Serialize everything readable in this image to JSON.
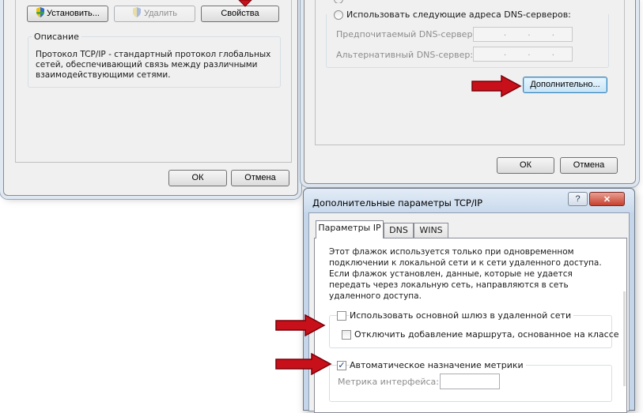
{
  "left_window": {
    "install_label": "Установить...",
    "remove_label": "Удалить",
    "properties_label": "Свойства",
    "description_title": "Описание",
    "description_text": "Протокол TCP/IP - стандартный протокол глобальных сетей, обеспечивающий связь между различными взаимодействующими сетями.",
    "ok_label": "ОК",
    "cancel_label": "Отмена"
  },
  "right_window": {
    "use_dns_label": "Использовать следующие адреса DNS-серверов:",
    "preferred_dns_label": "Предпочитаемый DNS-сервер:",
    "alternate_dns_label": "Альтернативный DNS-сервер:",
    "preferred_dns_value": ". . .",
    "alternate_dns_value": ". . .",
    "advanced_label": "Дополнительно...",
    "ok_label": "ОК",
    "cancel_label": "Отмена"
  },
  "advanced_dialog": {
    "title": "Дополнительные параметры TCP/IP",
    "help_button": "?",
    "close_button": "✕",
    "tabs": [
      {
        "label": "Параметры IP",
        "active": true
      },
      {
        "label": "DNS",
        "active": false
      },
      {
        "label": "WINS",
        "active": false
      }
    ],
    "info_text": "Этот флажок используется только при одновременном подключении к локальной сети и к сети удаленного доступа. Если флажок установлен, данные, которые не удается передать через локальную сеть, направляются в сеть удаленного доступа.",
    "use_gateway_label": "Использовать основной шлюз в удаленной сети",
    "use_gateway_checked": false,
    "disable_class_route_label": "Отключить добавление маршрута, основанное на классе",
    "disable_class_route_checked": false,
    "auto_metric_label": "Автоматическое назначение метрики",
    "auto_metric_checked": true,
    "interface_metric_label": "Метрика интерфейса:",
    "interface_metric_value": ""
  },
  "colors": {
    "arrow_fill": "#c8101a",
    "arrow_stroke": "#7a0008",
    "checkmark": "#1d3e6d"
  }
}
